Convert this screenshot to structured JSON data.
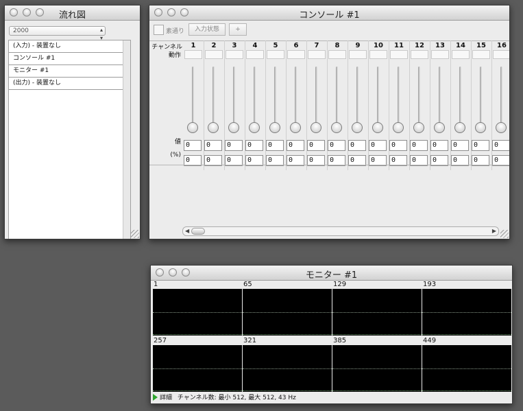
{
  "flow_window": {
    "title": "流れ図",
    "selector_value": "2000",
    "items": [
      "(入力) - 装置なし",
      "コンソール #1",
      "モニター #1",
      "(出力) - 装置なし"
    ]
  },
  "console_window": {
    "title": "コンソール #1",
    "toolbar": {
      "passthrough_label": "素通り",
      "input_state_label": "入力状態",
      "add_label": "+"
    },
    "row_labels": {
      "channel": "チャンネル",
      "action": "動作",
      "value": "値",
      "percent": "(%)"
    },
    "channels": [
      {
        "n": "1",
        "v": "0",
        "p": "0"
      },
      {
        "n": "2",
        "v": "0",
        "p": "0"
      },
      {
        "n": "3",
        "v": "0",
        "p": "0"
      },
      {
        "n": "4",
        "v": "0",
        "p": "0"
      },
      {
        "n": "5",
        "v": "0",
        "p": "0"
      },
      {
        "n": "6",
        "v": "0",
        "p": "0"
      },
      {
        "n": "7",
        "v": "0",
        "p": "0"
      },
      {
        "n": "8",
        "v": "0",
        "p": "0"
      },
      {
        "n": "9",
        "v": "0",
        "p": "0"
      },
      {
        "n": "10",
        "v": "0",
        "p": "0"
      },
      {
        "n": "11",
        "v": "0",
        "p": "0"
      },
      {
        "n": "12",
        "v": "0",
        "p": "0"
      },
      {
        "n": "13",
        "v": "0",
        "p": "0"
      },
      {
        "n": "14",
        "v": "0",
        "p": "0"
      },
      {
        "n": "15",
        "v": "0",
        "p": "0"
      },
      {
        "n": "16",
        "v": "0",
        "p": "0"
      }
    ]
  },
  "monitor_window": {
    "title": "モニター #1",
    "cells": [
      "1",
      "65",
      "129",
      "193",
      "257",
      "321",
      "385",
      "449"
    ],
    "status_label": "詳細",
    "status_text": "チャンネル数: 最小 512, 最大 512, 43 Hz"
  }
}
